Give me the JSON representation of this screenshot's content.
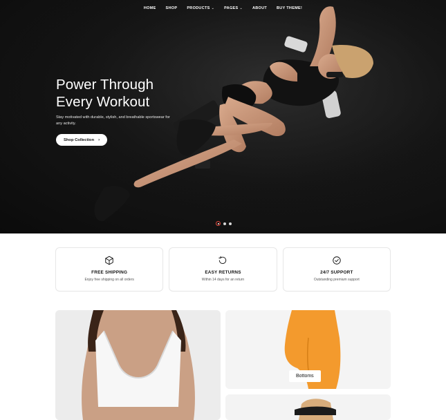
{
  "nav": {
    "items": [
      {
        "label": "HOME",
        "has_dropdown": false
      },
      {
        "label": "SHOP",
        "has_dropdown": false
      },
      {
        "label": "PRODUCTS",
        "has_dropdown": true
      },
      {
        "label": "PAGES",
        "has_dropdown": true
      },
      {
        "label": "ABOUT",
        "has_dropdown": false
      },
      {
        "label": "BUY THEME!",
        "has_dropdown": false
      }
    ],
    "dropdown_icon": "chevron-down-icon"
  },
  "hero": {
    "title_line1": "Power Through",
    "title_line2": "Every Workout",
    "subtitle": "Stay motivated with durable, stylish, and breathable sportswear for any activity.",
    "button_label": "Shop Collection",
    "button_icon": "arrow-right-icon",
    "slides_total": 3,
    "active_slide": 1,
    "accent_color": "#e2463a"
  },
  "features": [
    {
      "icon": "box-icon",
      "title": "FREE SHIPPING",
      "desc": "Enjoy free shipping on all orders"
    },
    {
      "icon": "return-icon",
      "title": "EASY RETURNS",
      "desc": "Within 14 days for an return"
    },
    {
      "icon": "check-circle-icon",
      "title": "24/7 SUPPORT",
      "desc": "Outstanding premium support"
    }
  ],
  "collections": {
    "bottoms_label": "Bottoms"
  }
}
